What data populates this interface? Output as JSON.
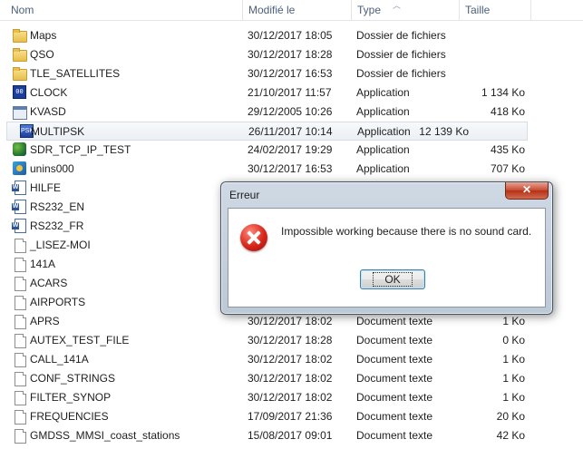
{
  "columns": {
    "name": "Nom",
    "date": "Modifié le",
    "type": "Type",
    "size": "Taille"
  },
  "files": [
    {
      "icon": "folder-icon",
      "name": "Maps",
      "date": "30/12/2017 18:05",
      "type": "Dossier de fichiers",
      "size": ""
    },
    {
      "icon": "folder-icon",
      "name": "QSO",
      "date": "30/12/2017 18:28",
      "type": "Dossier de fichiers",
      "size": ""
    },
    {
      "icon": "folder-icon",
      "name": "TLE_SATELLITES",
      "date": "30/12/2017 16:53",
      "type": "Dossier de fichiers",
      "size": ""
    },
    {
      "icon": "clock-app-icon",
      "name": "CLOCK",
      "date": "21/10/2017 11:57",
      "type": "Application",
      "size": "1 134 Ko"
    },
    {
      "icon": "kvasd-app-icon",
      "name": "KVASD",
      "date": "29/12/2005 10:26",
      "type": "Application",
      "size": "418 Ko"
    },
    {
      "icon": "multipsk-app-icon",
      "name": "MULTIPSK",
      "date": "26/11/2017 10:14",
      "type": "Application",
      "size": "12 139 Ko",
      "selected": true
    },
    {
      "icon": "sdr-app-icon",
      "name": "SDR_TCP_IP_TEST",
      "date": "24/02/2017 19:29",
      "type": "Application",
      "size": "435 Ko"
    },
    {
      "icon": "uninstaller-app-icon",
      "name": "unins000",
      "date": "30/12/2017 16:53",
      "type": "Application",
      "size": "707 Ko"
    },
    {
      "icon": "word-document-icon",
      "name": "HILFE",
      "date": "",
      "type": "",
      "size": ""
    },
    {
      "icon": "word-document-icon",
      "name": "RS232_EN",
      "date": "",
      "type": "",
      "size": ""
    },
    {
      "icon": "word-document-icon",
      "name": "RS232_FR",
      "date": "",
      "type": "",
      "size": ""
    },
    {
      "icon": "text-file-icon",
      "name": "_LISEZ-MOI",
      "date": "",
      "type": "",
      "size": ""
    },
    {
      "icon": "text-file-icon",
      "name": "141A",
      "date": "",
      "type": "",
      "size": ""
    },
    {
      "icon": "text-file-icon",
      "name": "ACARS",
      "date": "",
      "type": "",
      "size": ""
    },
    {
      "icon": "text-file-icon",
      "name": "AIRPORTS",
      "date": "",
      "type": "",
      "size": ""
    },
    {
      "icon": "text-file-icon",
      "name": "APRS",
      "date": "30/12/2017 18:02",
      "type": "Document texte",
      "size": "1 Ko"
    },
    {
      "icon": "text-file-icon",
      "name": "AUTEX_TEST_FILE",
      "date": "30/12/2017 18:28",
      "type": "Document texte",
      "size": "0 Ko"
    },
    {
      "icon": "text-file-icon",
      "name": "CALL_141A",
      "date": "30/12/2017 18:02",
      "type": "Document texte",
      "size": "1 Ko"
    },
    {
      "icon": "text-file-icon",
      "name": "CONF_STRINGS",
      "date": "30/12/2017 18:02",
      "type": "Document texte",
      "size": "1 Ko"
    },
    {
      "icon": "text-file-icon",
      "name": "FILTER_SYNOP",
      "date": "30/12/2017 18:02",
      "type": "Document texte",
      "size": "1 Ko"
    },
    {
      "icon": "text-file-icon",
      "name": "FREQUENCIES",
      "date": "17/09/2017 21:36",
      "type": "Document texte",
      "size": "20 Ko"
    },
    {
      "icon": "text-file-icon",
      "name": "GMDSS_MMSI_coast_stations",
      "date": "15/08/2017 09:01",
      "type": "Document texte",
      "size": "42 Ko"
    }
  ],
  "dialog": {
    "title": "Erreur",
    "close_label": "✕",
    "icon": "error-icon",
    "message": "Impossible working because there is no sound card.",
    "ok_label": "OK"
  }
}
